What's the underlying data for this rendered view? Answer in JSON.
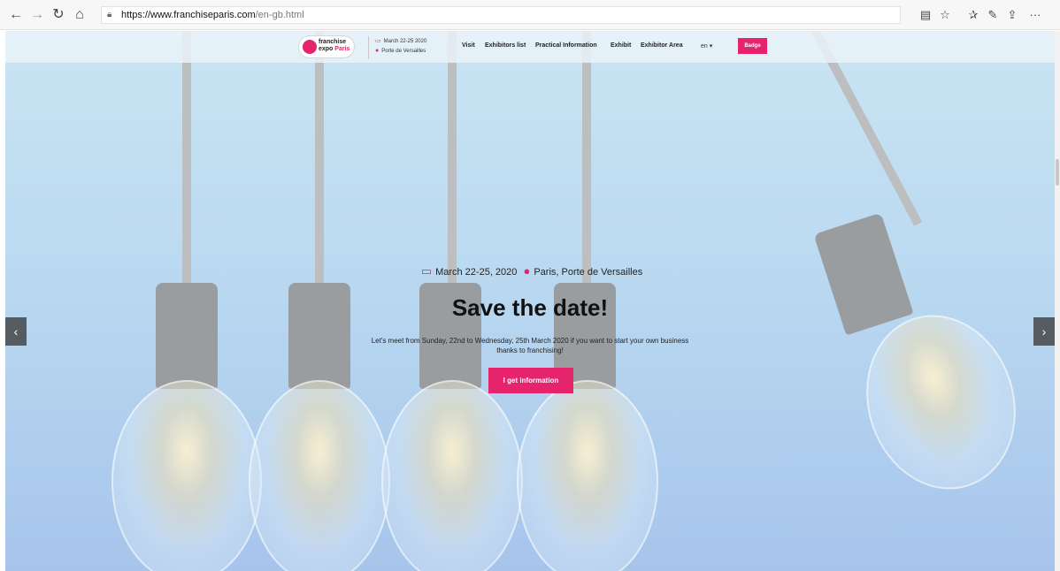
{
  "browser": {
    "url_host": "https://www.franchiseparis.com",
    "url_path": "/en-gb.html",
    "icons": [
      "back-icon",
      "forward-icon",
      "refresh-icon",
      "home-icon",
      "lock-icon",
      "reading-view-icon",
      "favorite-star-icon",
      "favorites-bar-icon",
      "pen-icon",
      "share-icon",
      "more-icon"
    ]
  },
  "header": {
    "logo_line1": "franchise",
    "logo_line2": "expo",
    "logo_paris": "Paris",
    "date": "March 22-25 2020",
    "venue": "Porte de Versailles",
    "nav": [
      "Visit",
      "Exhibitors list",
      "Practical Information",
      "Exhibit",
      "Exhibitor Area"
    ],
    "lang": "en",
    "badge": "Badge"
  },
  "hero": {
    "date": "March 22-25, 2020",
    "location": "Paris, Porte de Versailles",
    "title": "Save the date!",
    "description": "Let's meet from Sunday, 22nd to Wednesday, 25th March 2020 if you want to start your own business thanks to franchising!",
    "cta": "I get information"
  },
  "colors": {
    "accent": "#e5246c",
    "arrow_bg": "#555b60"
  }
}
